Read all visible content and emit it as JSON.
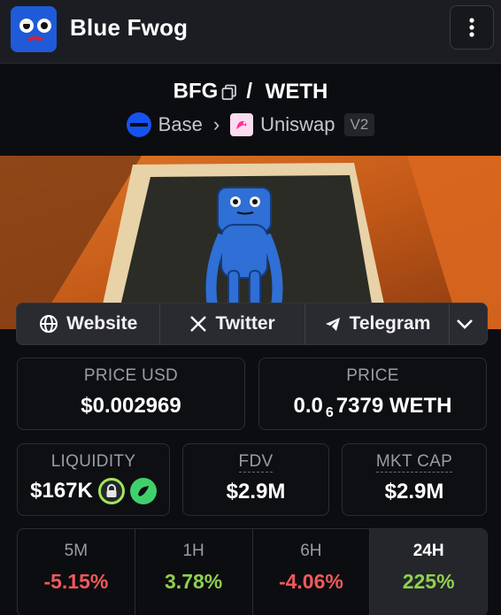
{
  "header": {
    "token_name": "Blue Fwog",
    "menu_icon": "more-vertical-icon"
  },
  "pair": {
    "base": "BFG",
    "separator": "/",
    "quote": "WETH",
    "chain": "Base",
    "dex": "Uniswap",
    "version": "V2"
  },
  "links": {
    "website": "Website",
    "twitter": "Twitter",
    "telegram": "Telegram"
  },
  "stats": {
    "price_usd_label": "PRICE USD",
    "price_usd": "$0.002969",
    "price_label": "PRICE",
    "price_prefix": "0.0",
    "price_zeros": "6",
    "price_rest": "7379 WETH",
    "liquidity_label": "LIQUIDITY",
    "liquidity": "$167K",
    "fdv_label": "FDV",
    "fdv": "$2.9M",
    "mktcap_label": "MKT CAP",
    "mktcap": "$2.9M"
  },
  "changes": [
    {
      "period": "5M",
      "value": "-5.15%"
    },
    {
      "period": "1H",
      "value": "3.78%"
    },
    {
      "period": "6H",
      "value": "-4.06%"
    },
    {
      "period": "24H",
      "value": "225%"
    }
  ],
  "colors": {
    "negative": "#ef5a5a",
    "positive": "#8fd04e",
    "base_chain": "#1652f0"
  }
}
